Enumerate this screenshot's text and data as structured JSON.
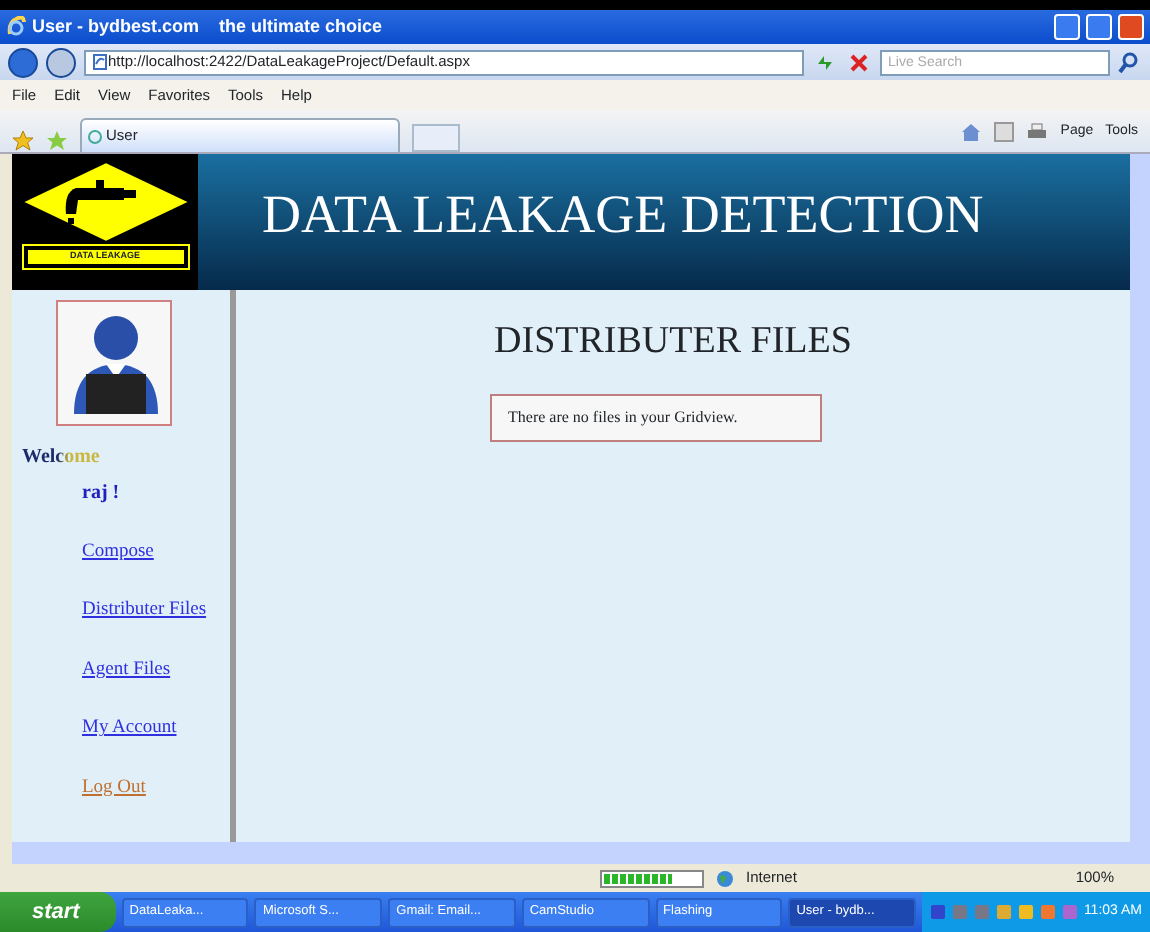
{
  "window": {
    "title": "User - bydbest.com    the ultimate choice"
  },
  "address_bar": {
    "url": "http://localhost:2422/DataLeakageProject/Default.aspx",
    "search_placeholder": "Live Search"
  },
  "menu": [
    "File",
    "Edit",
    "View",
    "Favorites",
    "Tools",
    "Help"
  ],
  "tabs": [
    {
      "label": "User",
      "selected": true
    }
  ],
  "command_bar": [
    "Page",
    "Tools"
  ],
  "page": {
    "banner_title": "DATA LEAKAGE DETECTION",
    "logo_caption": "DATA LEAKAGE",
    "welcome": "Welcome",
    "user": "raj !",
    "nav_links": [
      {
        "label": "Compose",
        "kind": "link"
      },
      {
        "label": "Distributer Files",
        "kind": "link"
      },
      {
        "label": "Agent Files",
        "kind": "link"
      },
      {
        "label": "My Account",
        "kind": "link"
      },
      {
        "label": "Log Out",
        "kind": "logout"
      }
    ],
    "heading": "DISTRIBUTER FILES",
    "message": "There are no files in your Gridview."
  },
  "status_bar": {
    "progress": {
      "level": 0.7
    },
    "zone": "Internet",
    "zoom": "100%"
  },
  "taskbar": {
    "start": "start",
    "items": [
      {
        "label": "DataLeaka...",
        "selected": false
      },
      {
        "label": "Microsoft S...",
        "selected": false
      },
      {
        "label": "Gmail: Email...",
        "selected": false
      },
      {
        "label": "CamStudio",
        "selected": false
      },
      {
        "label": "Flashing",
        "selected": false
      },
      {
        "label": "User - bydb...",
        "selected": true
      }
    ],
    "clock": "11:03 AM"
  }
}
